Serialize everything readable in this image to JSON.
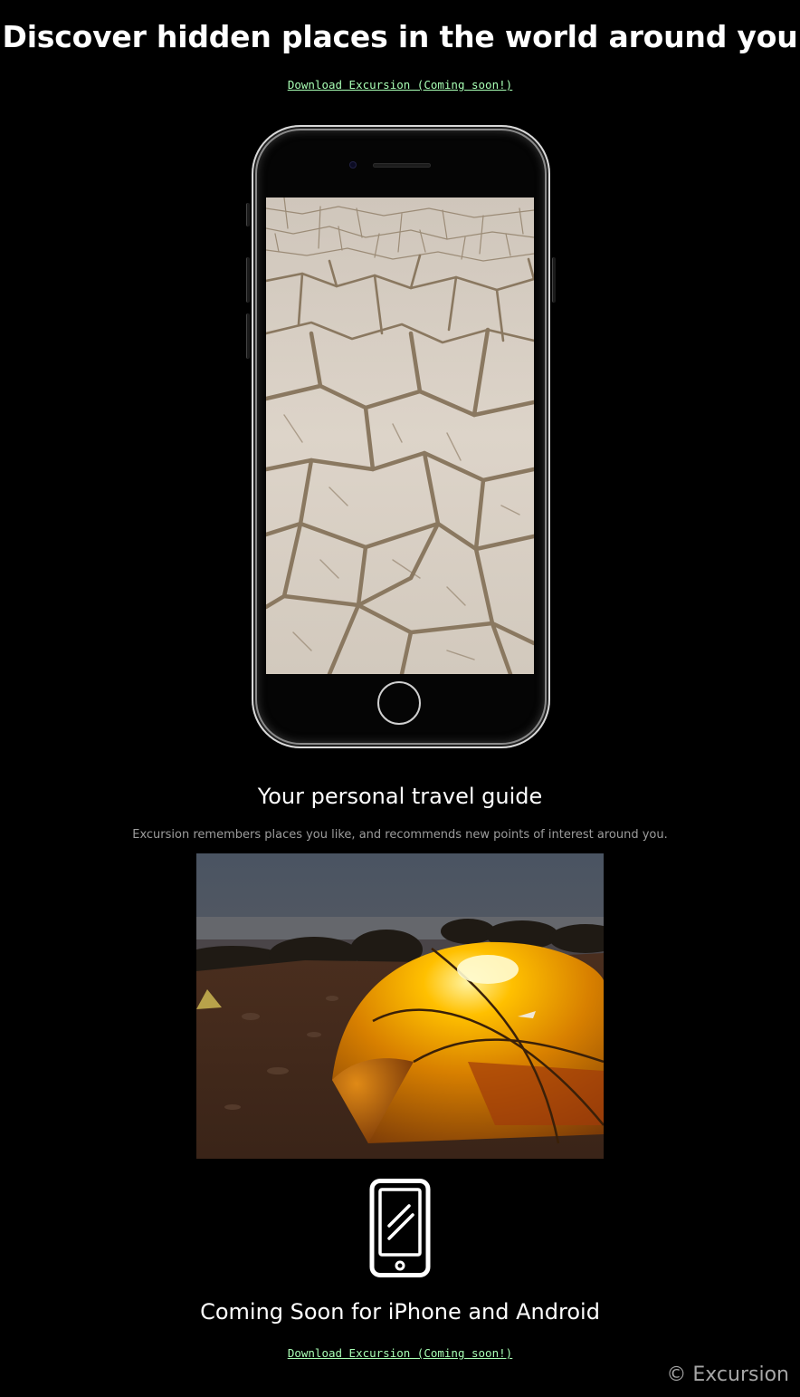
{
  "hero": {
    "title": "Discover hidden places in the world around you",
    "download_link_top": "Download Excursion (Coming soon!)"
  },
  "phone_mockup": {
    "screen_image": "cracked-desert-ground-photo"
  },
  "guide": {
    "title": "Your personal travel guide",
    "description": "Excursion remembers places you like, and recommends new points of interest around you.",
    "image": "glowing-tent-camp-at-dusk-photo"
  },
  "availability": {
    "icon": "smartphone-icon",
    "title": "Coming Soon for iPhone and Android",
    "download_link_bottom": "Download Excursion (Coming soon!)"
  },
  "footer": {
    "copyright": "© Excursion"
  },
  "colors": {
    "background": "#000000",
    "text": "#ffffff",
    "link": "#a8ffb4",
    "muted": "#9c9c9c",
    "copyright": "#a6a6a6"
  }
}
